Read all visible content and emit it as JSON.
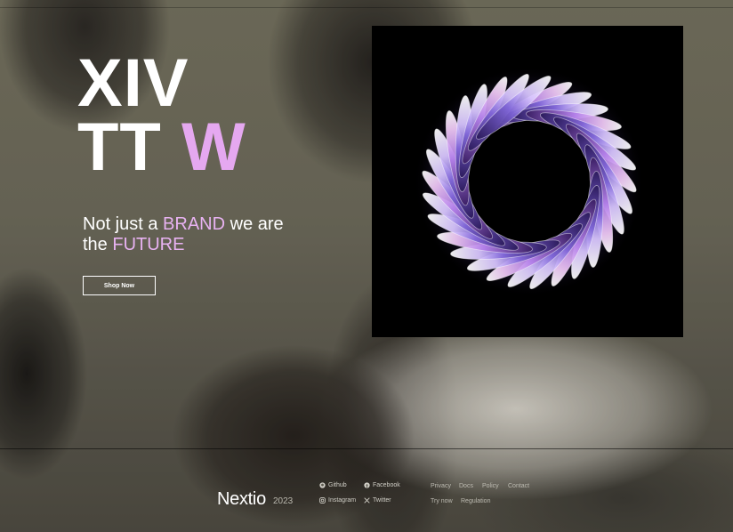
{
  "hero": {
    "title_line1": "XIV",
    "title_line2_main": "TT",
    "title_line2_accent": "W",
    "tagline_part1": "Not just a ",
    "tagline_brand": "BRAND",
    "tagline_part2": " we are",
    "tagline_part3": "the ",
    "tagline_future": "FUTURE",
    "cta_label": "Shop Now"
  },
  "footer": {
    "brand": "Nextio",
    "year": "2023",
    "social": {
      "github": "Github",
      "facebook": "Facebook",
      "instagram": "Instagram",
      "twitter": "Twitter"
    },
    "links": {
      "privacy": "Privacy",
      "docs": "Docs",
      "policy": "Policy",
      "contact": "Contact",
      "try_now": "Try now",
      "regulation": "Regulation"
    }
  },
  "icons": {
    "github": "github-icon",
    "facebook": "facebook-icon",
    "instagram": "instagram-icon",
    "twitter": "twitter-x-icon"
  },
  "colors": {
    "accent": "#e5a8f0",
    "text": "#ffffff",
    "panel": "#000000"
  }
}
